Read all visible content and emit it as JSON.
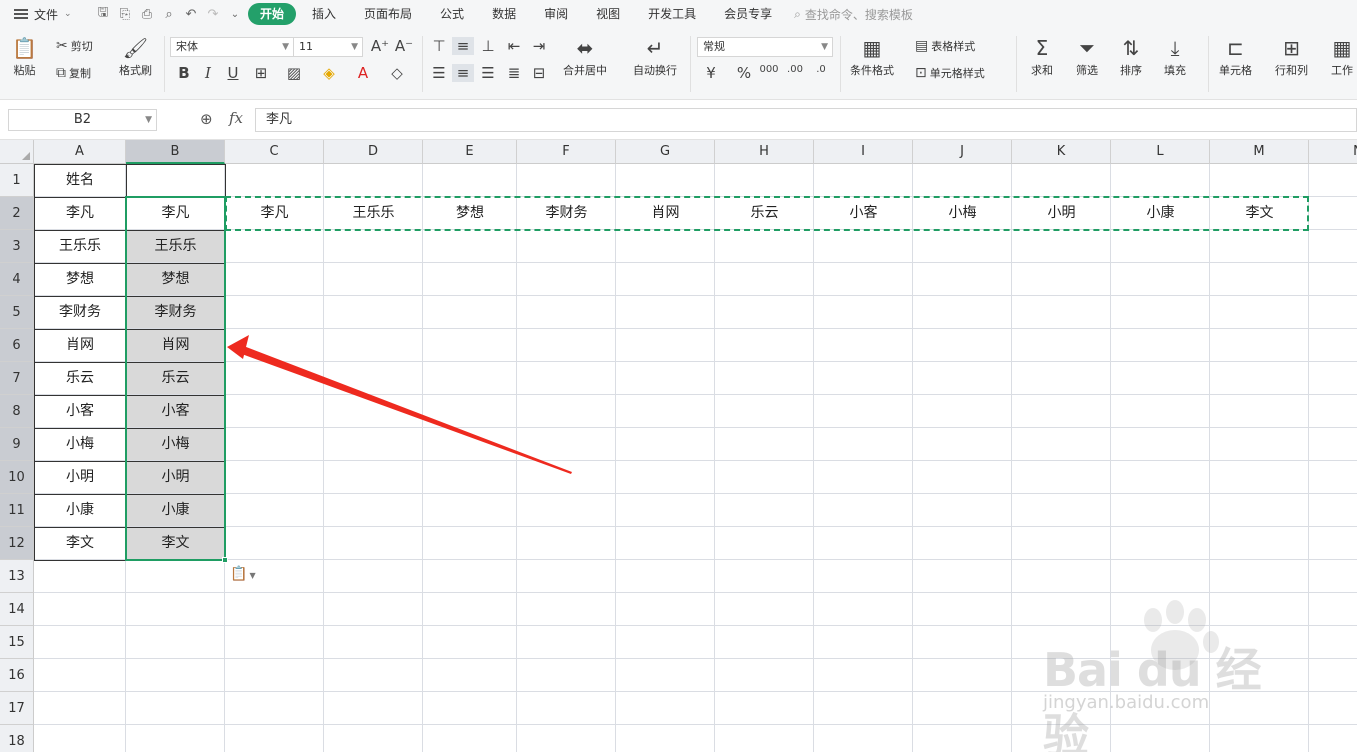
{
  "menubar": {
    "file_label": "文件",
    "tabs": [
      "开始",
      "插入",
      "页面布局",
      "公式",
      "数据",
      "审阅",
      "视图",
      "开发工具",
      "会员专享"
    ],
    "active_tab": "开始",
    "search_placeholder": "查找命令、搜索模板"
  },
  "ribbon": {
    "paste": "粘贴",
    "cut": "剪切",
    "copy": "复制",
    "format_painter": "格式刷",
    "font_name": "宋体",
    "font_size": "11",
    "merge_center": "合并居中",
    "wrap_text": "自动换行",
    "number_format": "常规",
    "conditional_format": "条件格式",
    "table_style": "表格样式",
    "cell_style": "单元格样式",
    "sum": "求和",
    "filter": "筛选",
    "sort": "排序",
    "fill": "填充",
    "cell": "单元格",
    "row_col": "行和列",
    "worksheet": "工作"
  },
  "formula_bar": {
    "cell_ref": "B2",
    "fx": "fx",
    "content": "李凡"
  },
  "sheet": {
    "columns": [
      "A",
      "B",
      "C",
      "D",
      "E",
      "F",
      "G",
      "H",
      "I",
      "J",
      "K",
      "L",
      "M",
      "N"
    ],
    "rows": [
      "1",
      "2",
      "3",
      "4",
      "5",
      "6",
      "7",
      "8",
      "9",
      "10",
      "11",
      "12",
      "13",
      "14",
      "15",
      "16",
      "17",
      "18"
    ],
    "selected_column": "B",
    "header_A": "姓名",
    "col_A": [
      "李凡",
      "王乐乐",
      "梦想",
      "李财务",
      "肖网",
      "乐云",
      "小客",
      "小梅",
      "小明",
      "小康",
      "李文"
    ],
    "col_B": [
      "李凡",
      "王乐乐",
      "梦想",
      "李财务",
      "肖网",
      "乐云",
      "小客",
      "小梅",
      "小明",
      "小康",
      "李文"
    ],
    "row_2_transposed": [
      "李凡",
      "王乐乐",
      "梦想",
      "李财务",
      "肖网",
      "乐云",
      "小客",
      "小梅",
      "小明",
      "小康",
      "李文"
    ]
  },
  "watermark": {
    "brand": "Bai du 经验",
    "url": "jingyan.baidu.com"
  }
}
